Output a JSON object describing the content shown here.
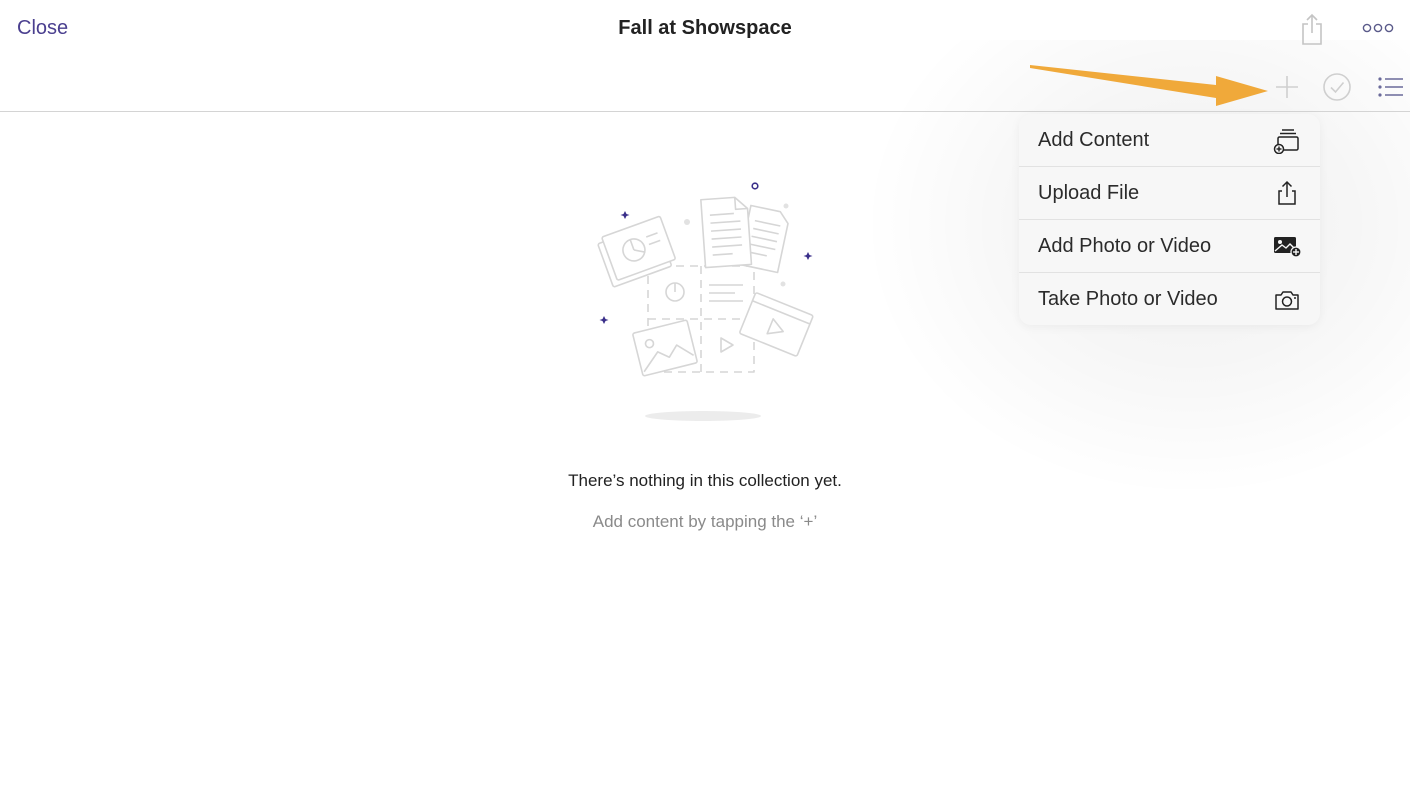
{
  "header": {
    "close_label": "Close",
    "title": "Fall at Showspace",
    "share_icon": "share-icon",
    "more_icon": "more-icon"
  },
  "toolbar": {
    "add_icon": "plus-icon",
    "select_icon": "checkmark-circle-icon",
    "list_icon": "list-icon"
  },
  "add_menu": {
    "items": [
      {
        "label": "Add Content",
        "icon": "add-content-icon"
      },
      {
        "label": "Upload File",
        "icon": "upload-icon"
      },
      {
        "label": "Add Photo or Video",
        "icon": "photo-add-icon"
      },
      {
        "label": "Take Photo or Video",
        "icon": "camera-icon"
      }
    ]
  },
  "empty_state": {
    "title": "There’s nothing in this collection yet.",
    "subtitle": "Add content by tapping the ‘+’"
  },
  "colors": {
    "accent": "#4a3f8f",
    "arrow": "#f0a93a",
    "divider": "#d4d4d4"
  }
}
